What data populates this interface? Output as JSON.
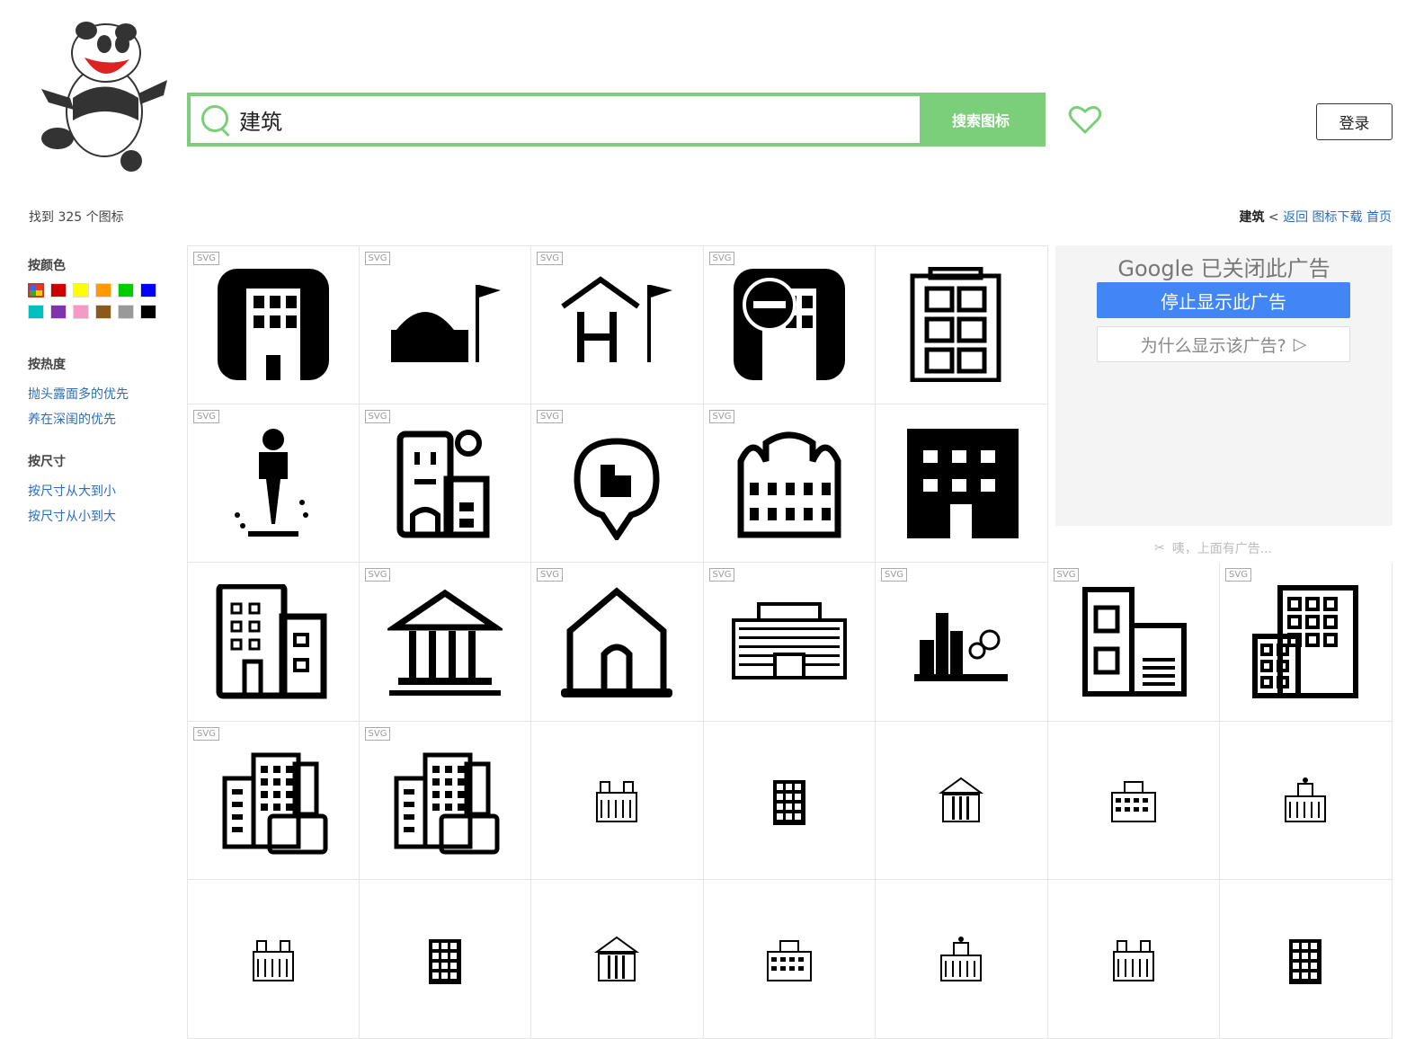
{
  "search": {
    "value": "建筑",
    "button": "搜索图标"
  },
  "header": {
    "login": "登录"
  },
  "result": {
    "count_text": "找到 325 个图标"
  },
  "breadcrumb": {
    "current": "建筑",
    "sep": " < ",
    "back": "返回",
    "download": "图标下载",
    "home": "首页"
  },
  "sidebar": {
    "color_title": "按颜色",
    "colors": [
      "multi",
      "#cc0000",
      "#ffff00",
      "#ff9900",
      "#00cc00",
      "#0000ff",
      "#00c0c0",
      "#8033aa",
      "#f59ac8",
      "#8b5a1a",
      "#999999",
      "#000000"
    ],
    "heat_title": "按热度",
    "heat_items": [
      "抛头露面多的优先",
      "养在深闺的优先"
    ],
    "size_title": "按尺寸",
    "size_items": [
      "按尺寸从大到小",
      "按尺寸从小到大"
    ]
  },
  "ad": {
    "brand": "Google",
    "closed": "已关闭此广告",
    "stop": "停止显示此广告",
    "why": "为什么显示该广告?",
    "note": "咦，上面有广告..."
  },
  "grid": {
    "badge": "SVG",
    "icons": [
      {
        "name": "office-building-rounded-icon",
        "svg": true
      },
      {
        "name": "dome-flag-icon",
        "svg": true
      },
      {
        "name": "hotel-flag-icon",
        "svg": true
      },
      {
        "name": "building-no-entry-icon",
        "svg": true
      },
      {
        "name": "tall-building-outline-icon",
        "svg": false
      },
      {
        "name": "construction-worker-icon",
        "svg": true
      },
      {
        "name": "building-satellite-icon",
        "svg": true
      },
      {
        "name": "location-building-icon",
        "svg": true
      },
      {
        "name": "townhouse-icon",
        "svg": true
      },
      {
        "name": "apartment-block-icon",
        "svg": false
      },
      {
        "name": "office-complex-icon",
        "svg": false
      },
      {
        "name": "bank-columns-icon",
        "svg": true
      },
      {
        "name": "house-arch-icon",
        "svg": true
      },
      {
        "name": "wide-building-icon",
        "svg": true
      },
      {
        "name": "city-trees-icon",
        "svg": true
      },
      {
        "name": "building-garage-icon",
        "svg": true
      },
      {
        "name": "tower-block-icon",
        "svg": true
      },
      {
        "name": "business-city-icon",
        "svg": true
      },
      {
        "name": "business-city-alt-icon",
        "svg": true
      },
      {
        "name": "small-tower-icon",
        "svg": false
      },
      {
        "name": "small-museum-icon",
        "svg": false
      },
      {
        "name": "small-school-icon",
        "svg": false
      },
      {
        "name": "small-hall-icon",
        "svg": false
      },
      {
        "name": "small-factory-icon",
        "svg": false
      },
      {
        "name": "small-clock-building-icon",
        "svg": false
      },
      {
        "name": "small-skyscraper-icon",
        "svg": false
      },
      {
        "name": "small-dome-building-icon",
        "svg": false
      },
      {
        "name": "small-columns-building-icon",
        "svg": false
      },
      {
        "name": "small-columns-building-alt-icon",
        "svg": false
      },
      {
        "name": "small-palace-icon",
        "svg": false
      },
      {
        "name": "small-flag-building-icon",
        "svg": false
      }
    ]
  }
}
